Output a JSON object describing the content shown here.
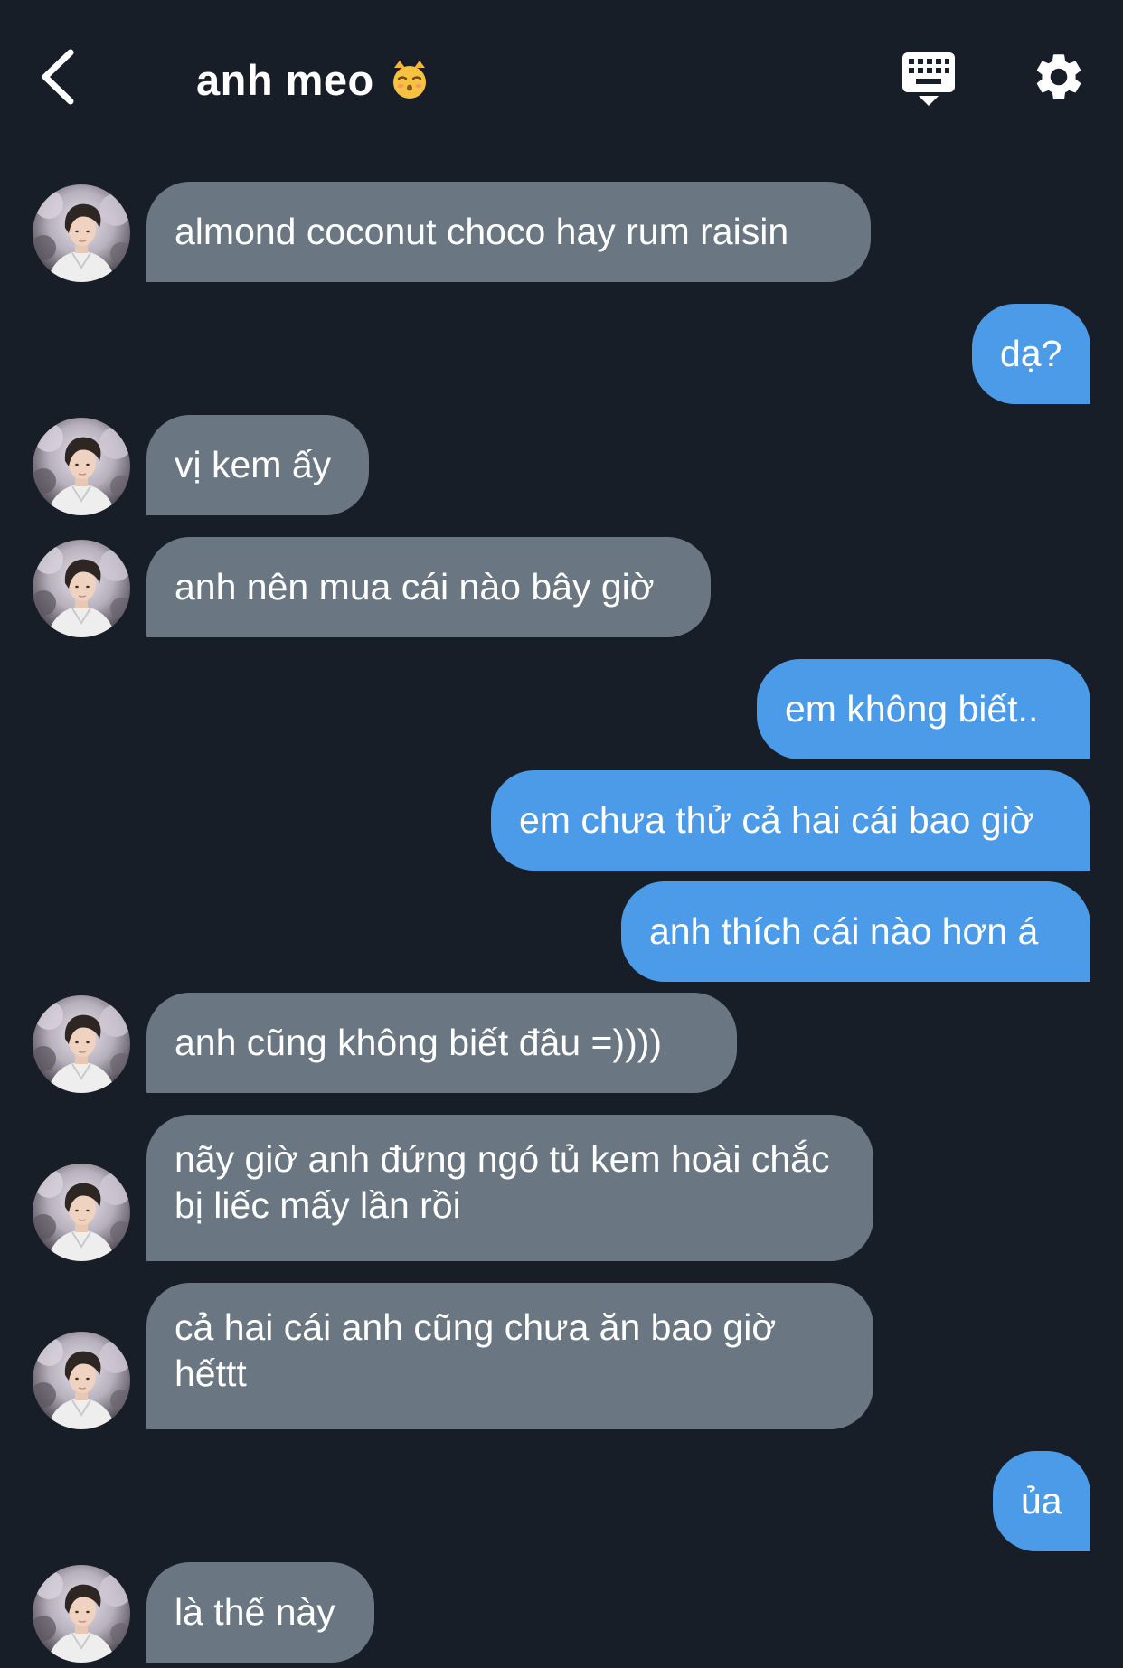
{
  "header": {
    "title": "anh meo",
    "title_emoji": "😽"
  },
  "messages": [
    {
      "side": "in",
      "text": "almond coconut choco hay rum raisin"
    },
    {
      "side": "out",
      "text": "dạ?"
    },
    {
      "side": "in",
      "text": "vị kem ấy"
    },
    {
      "side": "in",
      "text": "anh nên mua cái nào bây giờ"
    },
    {
      "side": "out",
      "text": "em không biết.."
    },
    {
      "side": "out",
      "text": "em chưa thử cả hai cái bao giờ"
    },
    {
      "side": "out",
      "text": "anh thích cái nào hơn á"
    },
    {
      "side": "in",
      "text": "anh cũng không biết đâu =))))"
    },
    {
      "side": "in",
      "text": "nãy giờ anh đứng ngó tủ kem hoài chắc bị liếc mấy lần rồi"
    },
    {
      "side": "in",
      "text": "cả hai cái anh cũng chưa ăn bao giờ hếttt"
    },
    {
      "side": "out",
      "text": "ủa"
    },
    {
      "side": "in",
      "text": "là thế này"
    }
  ],
  "colors": {
    "background": "#171e28",
    "incoming_bubble": "#6a7782",
    "outgoing_bubble": "#4b9be8",
    "text": "#ffffff"
  },
  "icons": {
    "back": "chevron-left-icon",
    "keyboard": "keyboard-icon",
    "settings": "gear-icon",
    "avatar": "profile-photo"
  }
}
